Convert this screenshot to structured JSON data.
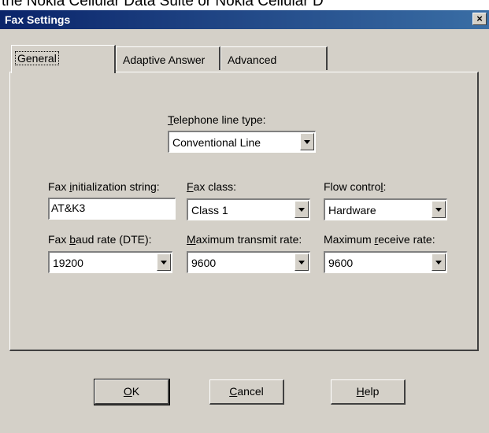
{
  "background_caption": "the Nokia Cellular Data Suite or Nokia Cellular D",
  "window": {
    "title": "Fax Settings",
    "close_glyph": "×"
  },
  "tabs": [
    {
      "label": "General",
      "active": true
    },
    {
      "label": "Adaptive Answer",
      "active": false
    },
    {
      "label": "Advanced",
      "active": false
    }
  ],
  "general": {
    "line_type": {
      "label_pre": "",
      "label_key": "T",
      "label_post": "elephone line type:",
      "value": "Conventional Line"
    },
    "init_string": {
      "label_pre": "Fax ",
      "label_key": "i",
      "label_post": "nitialization string:",
      "value": "AT&K3"
    },
    "fax_class": {
      "label_pre": "",
      "label_key": "F",
      "label_post": "ax class:",
      "value": "Class 1"
    },
    "flow_control": {
      "label_pre": "Flow contro",
      "label_key": "l",
      "label_post": ":",
      "value": "Hardware"
    },
    "baud_rate": {
      "label_pre": "Fax ",
      "label_key": "b",
      "label_post": "aud rate (DTE):",
      "value": "19200"
    },
    "max_transmit": {
      "label_pre": "",
      "label_key": "M",
      "label_post": "aximum transmit rate:",
      "value": "9600"
    },
    "max_receive": {
      "label_pre": "Maximum ",
      "label_key": "r",
      "label_post": "eceive rate:",
      "value": "9600"
    }
  },
  "buttons": {
    "ok": {
      "key": "O",
      "rest": "K"
    },
    "cancel": {
      "key": "C",
      "rest": "ancel"
    },
    "help": {
      "key": "H",
      "rest": "elp"
    }
  }
}
